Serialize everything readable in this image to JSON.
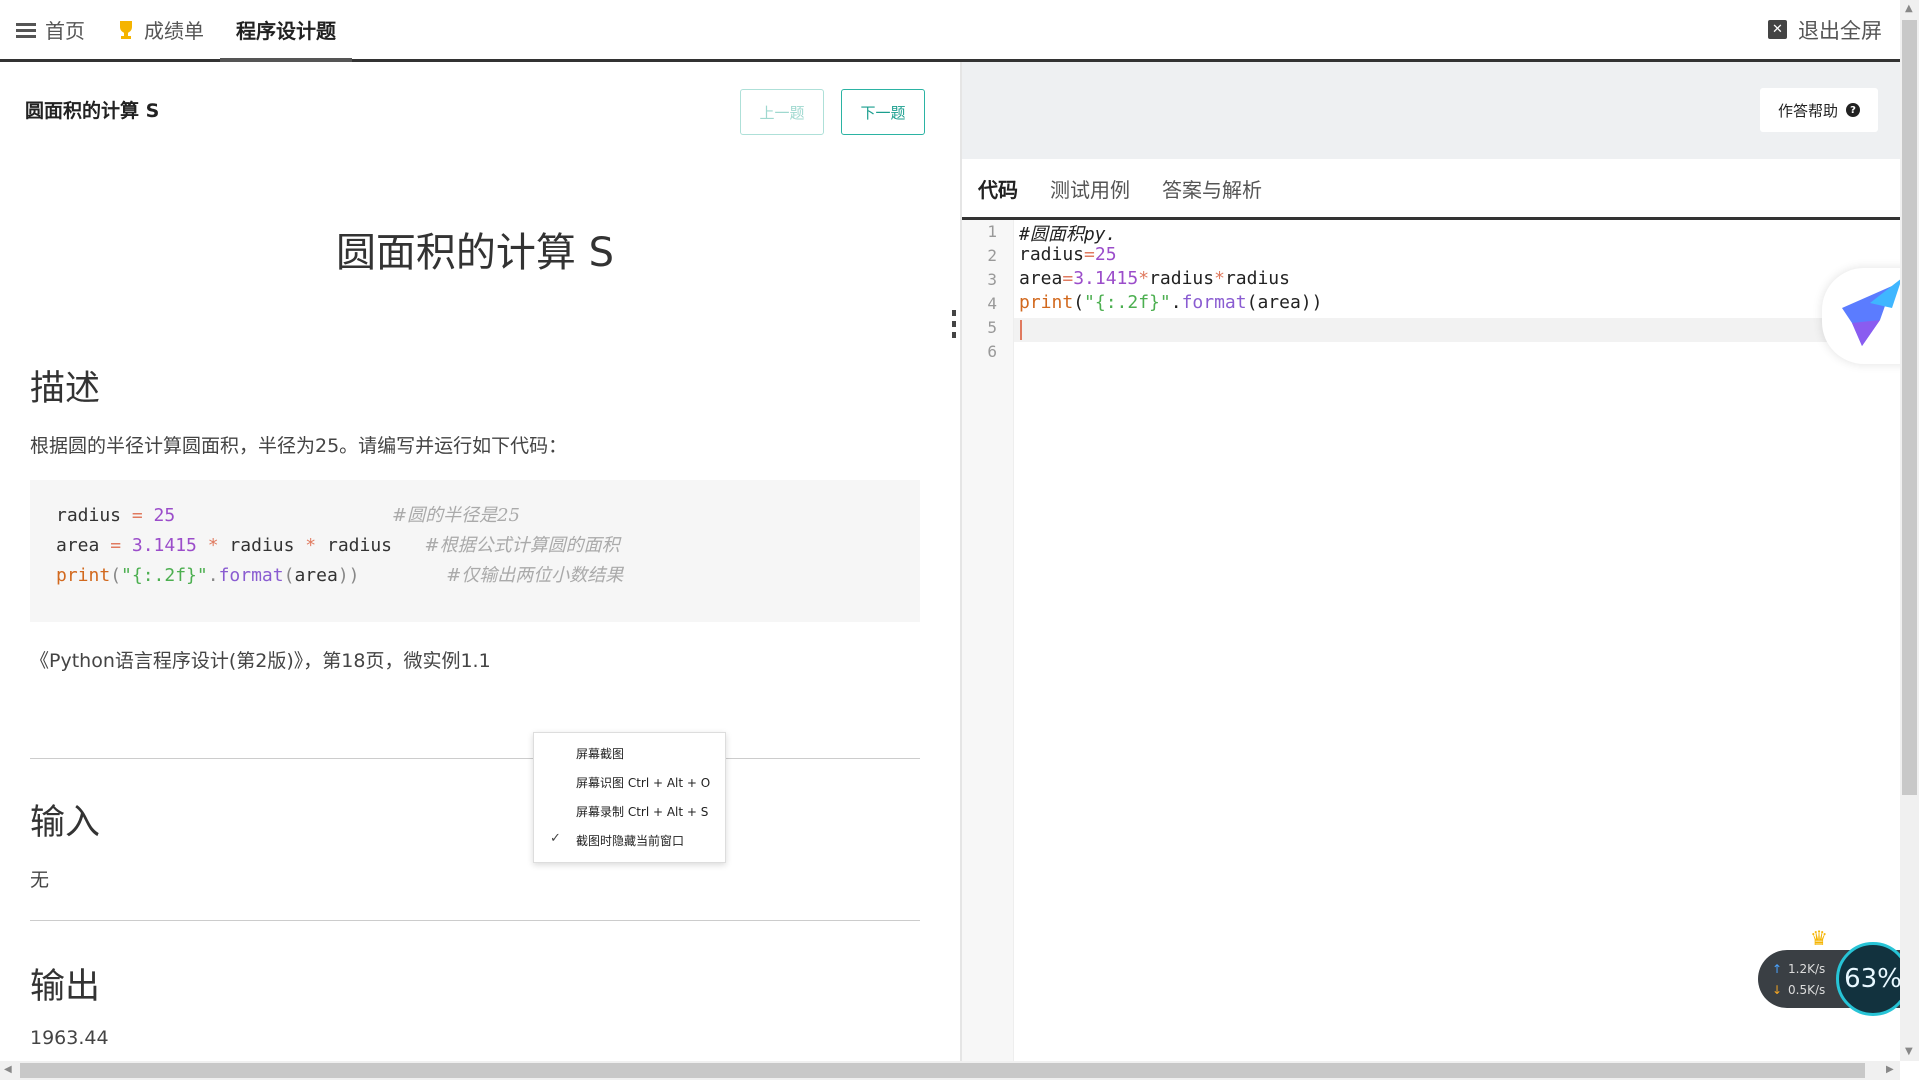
{
  "nav": {
    "items": [
      {
        "label": "首页",
        "icon": "list-icon"
      },
      {
        "label": "成绩单",
        "icon": "trophy-icon"
      },
      {
        "label": "程序设计题",
        "icon": ""
      }
    ],
    "exit_fullscreen": "退出全屏"
  },
  "question": {
    "title": "圆面积的计算 S",
    "prev_label": "上一题",
    "next_label": "下一题",
    "heading": "圆面积的计算 S",
    "desc_heading": "描述",
    "desc_text": "根据圆的半径计算圆面积，半径为25。请编写并运行如下代码：",
    "code_lines": [
      {
        "code": "radius = 25",
        "comment": "#圆的半径是25"
      },
      {
        "code": "area = 3.1415 * radius * radius",
        "comment": "#根据公式计算圆的面积"
      },
      {
        "code": "print(\"{:.2f}\".format(area))",
        "comment": "#仅输出两位小数结果"
      }
    ],
    "reference": "《Python语言程序设计(第2版)》，第18页，微实例1.1",
    "input_heading": "输入",
    "input_text": "无",
    "output_heading": "输出",
    "output_text": "1963.44"
  },
  "right": {
    "help_label": "作答帮助",
    "tabs": [
      "代码",
      "测试用例",
      "答案与解析"
    ],
    "editor_lines": [
      "#圆面积py.",
      "radius=25",
      "area=3.1415*radius*radius",
      "print(\"{:.2f}\".format(area))",
      "",
      ""
    ],
    "line_numbers": [
      "1",
      "2",
      "3",
      "4",
      "5",
      "6"
    ]
  },
  "context_menu": {
    "items": [
      "屏幕截图",
      "屏幕识图 Ctrl + Alt + O",
      "屏幕录制 Ctrl + Alt + S",
      "截图时隐藏当前窗口"
    ],
    "checked_index": 3
  },
  "net_widget": {
    "up": "1.2K/s",
    "down": "0.5K/s",
    "percent": "63%"
  },
  "colors": {
    "accent": "#2bb3a3",
    "tab_border": "#333333"
  }
}
